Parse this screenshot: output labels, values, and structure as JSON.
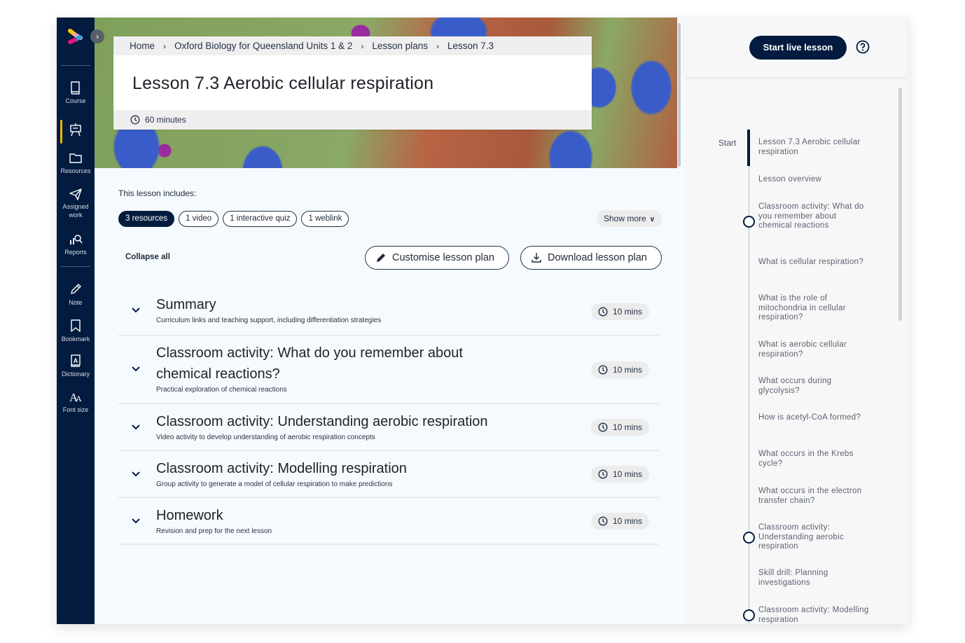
{
  "sidebar": {
    "items": [
      {
        "label": "Course",
        "icon": "book-icon"
      },
      {
        "label": "",
        "icon": "lesson-plan-easel-icon",
        "active": true
      },
      {
        "label": "Resources",
        "icon": "folder-icon"
      },
      {
        "label": "Assigned work",
        "icon": "paper-plane-icon"
      },
      {
        "label": "Reports",
        "icon": "reports-icon"
      },
      {
        "label": "Note",
        "icon": "pencil-icon"
      },
      {
        "label": "Bookmark",
        "icon": "bookmark-icon"
      },
      {
        "label": "Dictionary",
        "icon": "dictionary-icon"
      },
      {
        "label": "Font size",
        "icon": "font-size-icon"
      }
    ],
    "accent_color": "#f0b400",
    "background_color": "#031b3f"
  },
  "header": {
    "breadcrumb": [
      "Home",
      "Oxford Biology for Queensland Units 1 & 2",
      "Lesson plans",
      "Lesson 7.3"
    ],
    "title": "Lesson 7.3 Aerobic cellular respiration",
    "duration": "60 minutes"
  },
  "includes": {
    "label": "This lesson includes:",
    "chips": [
      {
        "label": "3 resources",
        "active": true
      },
      {
        "label": "1 video"
      },
      {
        "label": "1 interactive quiz"
      },
      {
        "label": "1 weblink"
      }
    ],
    "show_more": "Show more"
  },
  "actions": {
    "collapse_all": "Collapse all",
    "customise": "Customise lesson plan",
    "download": "Download lesson plan"
  },
  "sections": [
    {
      "title": "Summary",
      "subtitle": "Curriculum links and teaching support, including differentiation strategies",
      "time": "10 mins"
    },
    {
      "title": "Classroom activity:  What do you remember about chemical reactions?",
      "subtitle": "Practical exploration of chemical reactions",
      "time": "10 mins"
    },
    {
      "title": "Classroom activity: Understanding aerobic respiration",
      "subtitle": "Video activity to develop understanding of aerobic respiration concepts",
      "time": "10 mins"
    },
    {
      "title": "Classroom activity: Modelling respiration",
      "subtitle": "Group activity to generate a model of cellular respiration to make predictions",
      "time": "10 mins"
    },
    {
      "title": "Homework",
      "subtitle": "Revision and prep for the next lesson",
      "time": "10 mins"
    }
  ],
  "right_panel": {
    "start_live": "Start live lesson",
    "start_label": "Start",
    "timeline": [
      {
        "label": "Lesson 7.3 Aerobic cellular respiration",
        "current": true
      },
      {
        "label": "Lesson overview"
      },
      {
        "label": "Classroom activity: What do you remember about chemical reactions",
        "milestone": true
      },
      {
        "label": "What is cellular respiration?"
      },
      {
        "label": "What is the role of mitochondria in cellular respiration?"
      },
      {
        "label": "What is aerobic cellular respiration?"
      },
      {
        "label": "What occurs during glycolysis?"
      },
      {
        "label": "How is acetyl-CoA formed?"
      },
      {
        "label": "What occurs in the Krebs cycle?"
      },
      {
        "label": "What occurs in the electron transfer chain?"
      },
      {
        "label": "Classroom activity: Understanding aerobic respiration",
        "milestone": true
      },
      {
        "label": "Skill drill: Planning investigations"
      },
      {
        "label": "Classroom activity: Modelling respiration",
        "milestone": true
      }
    ]
  }
}
